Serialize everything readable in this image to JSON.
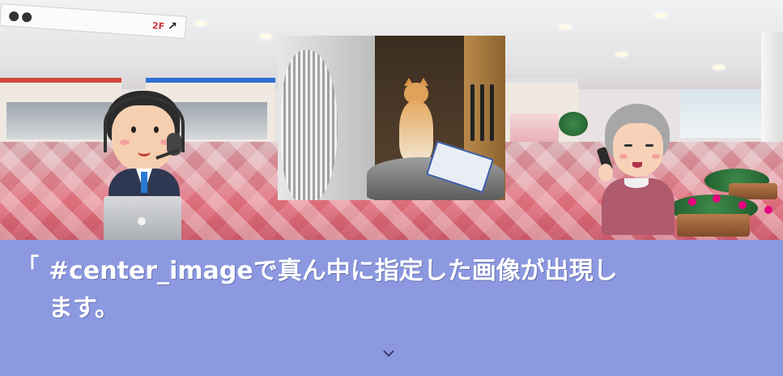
{
  "scene": {
    "signboard": {
      "floor_label": "2F"
    },
    "center_image": {
      "icon": "photo-cat-in-cabinet"
    },
    "left_character": {
      "icon": "call-center-operator-icon"
    },
    "right_character": {
      "icon": "grandmother-on-phone-icon"
    }
  },
  "message": {
    "open_quote": "「",
    "text": "#center_imageで真ん中に指定した画像が出現し\nます。",
    "next_indicator_icon": "chevron-down-icon"
  },
  "colors": {
    "message_window": "#8c99e0",
    "message_text": "#ffffff"
  }
}
